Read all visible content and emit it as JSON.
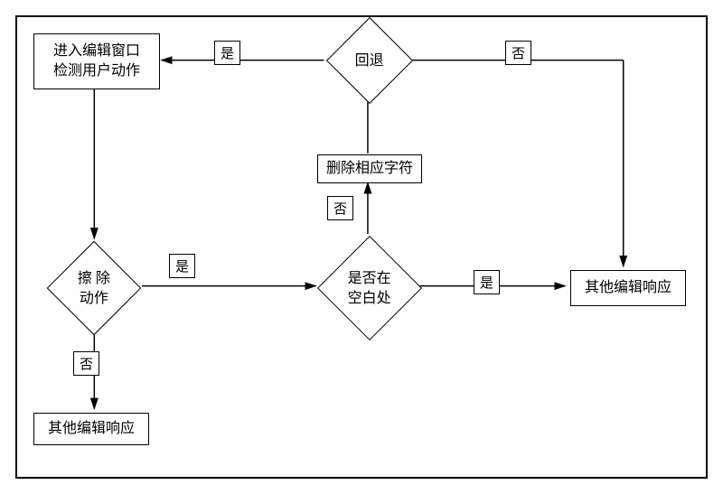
{
  "nodes": {
    "start": "进入编辑窗口\n检测用户动作",
    "eraseAction": "擦 除\n动作",
    "goBack": "回退",
    "atBlank": "是否在\n空白处",
    "deleteChar": "删除相应字符",
    "otherResp1": "其他编辑响应",
    "otherResp2": "其他编辑响应"
  },
  "labels": {
    "yes": "是",
    "no": "否"
  }
}
